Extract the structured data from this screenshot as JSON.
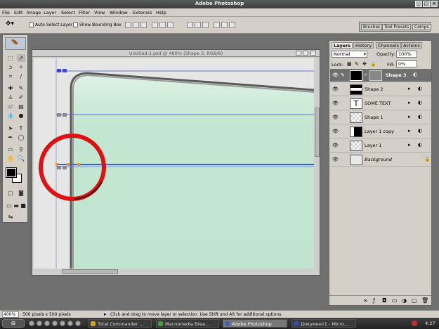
{
  "app": {
    "title": "Adobe Photoshop"
  },
  "menu": [
    "File",
    "Edit",
    "Image",
    "Layer",
    "Select",
    "Filter",
    "View",
    "Window",
    "Extensis",
    "Help"
  ],
  "options": {
    "auto_select_layer": "Auto Select Layer",
    "show_bounding_box": "Show Bounding Box"
  },
  "palette_well": {
    "tabs": [
      "Brushes",
      "Tool Presets",
      "Comps"
    ]
  },
  "document": {
    "title": "Untitled-1.psd @ 400% (Shape 3, RGB/8)",
    "canvas_bg": "#c0e4cc",
    "highlight_color": "#e01010"
  },
  "layers_panel": {
    "tabs": [
      "Layers",
      "History",
      "Channels",
      "Actions"
    ],
    "blend_mode": "Normal",
    "opacity_label": "Opacity:",
    "opacity": "100%",
    "lock_label": "Lock:",
    "fill_label": "Fill:",
    "fill": "0%",
    "layers": [
      {
        "name": "Shape 3",
        "selected": true
      },
      {
        "name": "Shape 2"
      },
      {
        "name": "SOME TEXT"
      },
      {
        "name": "Shape 1"
      },
      {
        "name": "Layer 1 copy"
      },
      {
        "name": "Layer 1"
      },
      {
        "name": "Background"
      }
    ]
  },
  "status": {
    "zoom": "400%",
    "doc_size": "500 pixels x 500 pixels",
    "hint": "Click and drag to move layer or selection. Use Shift and Alt for additional options."
  },
  "taskbar": {
    "items": [
      "Total Commander ...",
      "Macromedia Brea...",
      "Adobe Photoshop",
      "Документ1 - Micro..."
    ],
    "active_index": 2,
    "clock": "4:27"
  }
}
